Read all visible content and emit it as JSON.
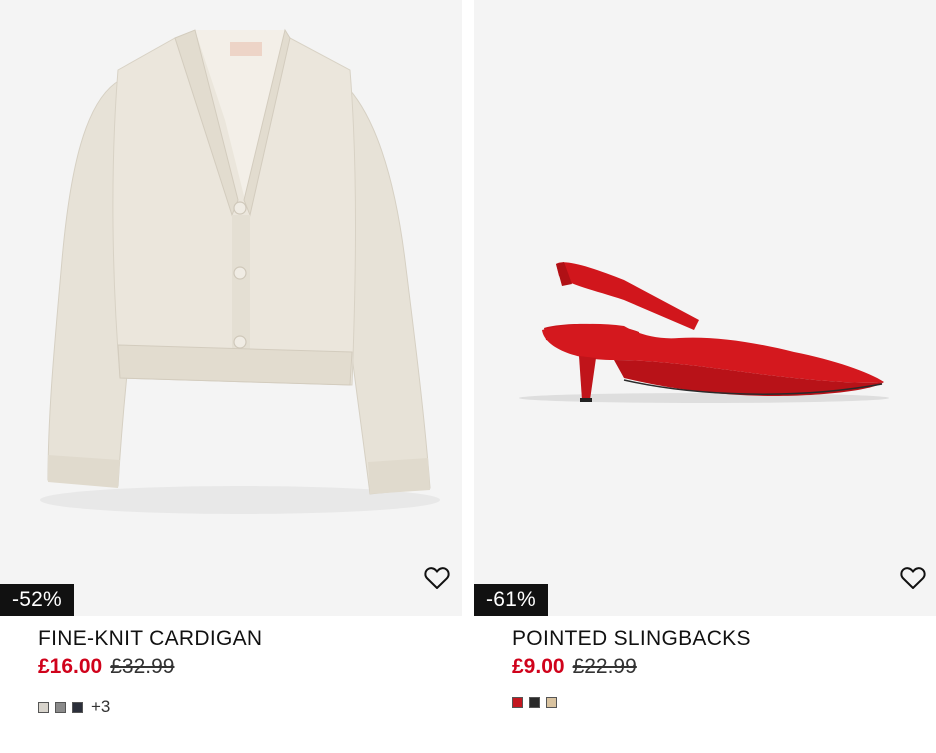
{
  "products": [
    {
      "name": "FINE-KNIT CARDIGAN",
      "sale_price": "£16.00",
      "original_price": "£32.99",
      "discount": "-52%",
      "image": "beige-cardigan-image",
      "swatches": [
        "#d8d4cc",
        "#8a8a8a",
        "#2b2f3a"
      ],
      "more_colors": "+3"
    },
    {
      "name": "POINTED SLINGBACKS",
      "sale_price": "£9.00",
      "original_price": "£22.99",
      "discount": "-61%",
      "image": "red-slingback-shoe-image",
      "swatches": [
        "#c3171f",
        "#2a2a2a",
        "#d9c3a0"
      ]
    }
  ],
  "icons": {
    "favorite": "heart-outline-icon"
  },
  "colors": {
    "sale": "#d0021b",
    "badge_bg": "#111111",
    "image_bg": "#f4f4f4"
  }
}
